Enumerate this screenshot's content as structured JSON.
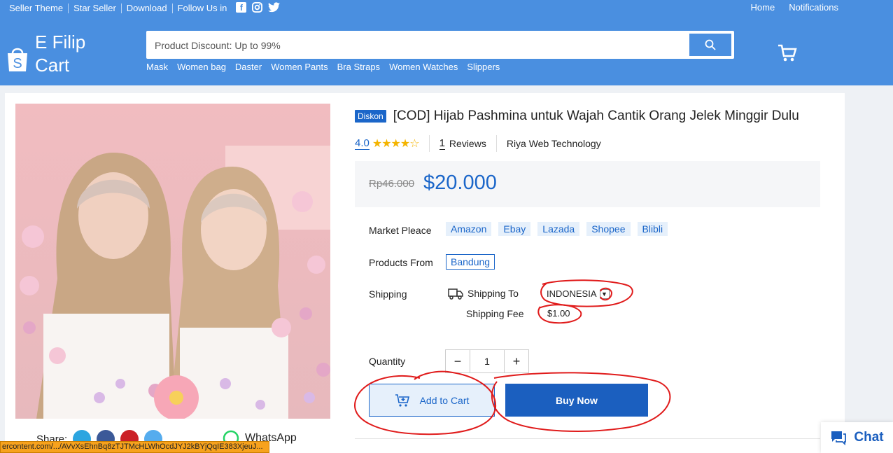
{
  "topbar": {
    "left_links": [
      "Seller Theme",
      "Star Seller",
      "Download",
      "Follow Us in"
    ],
    "right_links": [
      "Home",
      "Notifications"
    ]
  },
  "logo": {
    "line1": "E Filip",
    "line2": "Cart"
  },
  "search": {
    "placeholder": "Product Discount: Up to 99%"
  },
  "categories": [
    "Mask",
    "Women bag",
    "Daster",
    "Women Pants",
    "Bra Straps",
    "Women Watches",
    "Slippers"
  ],
  "product": {
    "badge": "Diskon",
    "title": "[COD] Hijab Pashmina untuk Wajah Cantik Orang Jelek Minggir Dulu",
    "rating": "4.0",
    "rating_value": 4,
    "reviews_count": "1",
    "reviews_label": "Reviews",
    "seller": "Riya Web Technology",
    "old_price": "Rp46.000",
    "price": "$20.000",
    "market_label": "Market Pleace",
    "markets": [
      "Amazon",
      "Ebay",
      "Lazada",
      "Shopee",
      "Blibli"
    ],
    "from_label": "Products From",
    "from_value": "Bandung",
    "shipping_label": "Shipping",
    "shipping_to_label": "Shipping To",
    "shipping_country": "INDONESIA",
    "shipping_fee_label": "Shipping Fee",
    "shipping_fee": "$1.00",
    "quantity_label": "Quantity",
    "quantity": "1",
    "add_to_cart": "Add to Cart",
    "buy_now": "Buy Now"
  },
  "share": {
    "label": "Share:",
    "whatsapp": "WhatsApp"
  },
  "chat": {
    "label": "Chat"
  },
  "statusbar": {
    "url": "ercontent.com/.../AVvXsEhnBq8zTJTMcHLWhOcdJYJ2kBYjQqIE383XjeuJ..."
  },
  "colors": {
    "header": "#4a8fe0",
    "accent": "#1b66c9",
    "annotation": "#e01b1b"
  }
}
